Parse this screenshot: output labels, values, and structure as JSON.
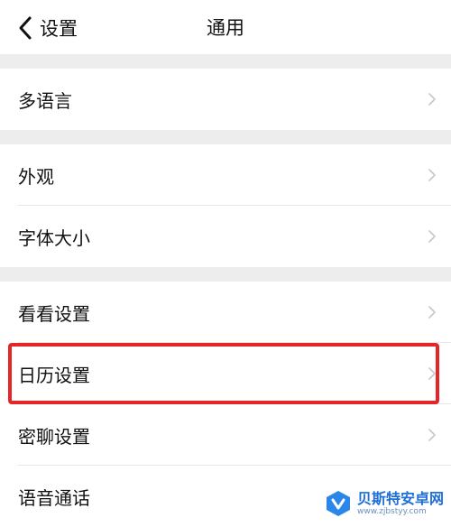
{
  "header": {
    "back_label": "设置",
    "title": "通用"
  },
  "sections": [
    {
      "items": [
        {
          "label": "多语言"
        }
      ]
    },
    {
      "items": [
        {
          "label": "外观"
        },
        {
          "label": "字体大小"
        }
      ]
    },
    {
      "items": [
        {
          "label": "看看设置"
        },
        {
          "label": "日历设置"
        },
        {
          "label": "密聊设置"
        },
        {
          "label": "语音通话"
        }
      ]
    }
  ],
  "highlight": {
    "target": "日历设置",
    "color": "#e4262b"
  },
  "watermark": {
    "name": "贝斯特安卓网",
    "url": "www.zjbstyy.com"
  },
  "colors": {
    "background": "#ededed",
    "surface": "#ffffff",
    "chevron": "#c7c7cc",
    "accent": "#e4262b"
  }
}
